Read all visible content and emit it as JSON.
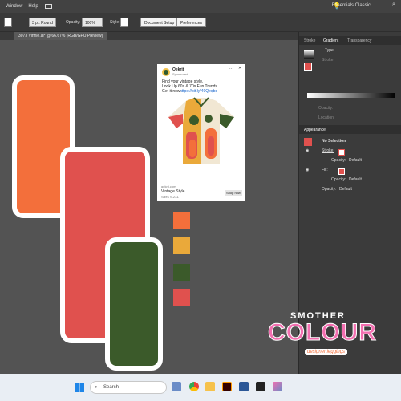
{
  "menu": {
    "items": [
      "Window",
      "Help"
    ],
    "workspace": "Essentials Classic"
  },
  "control_bar": {
    "stroke_weight": "3 pt. Round",
    "opacity_label": "Opacity:",
    "opacity_value": "100%",
    "style_label": "Style:",
    "document_setup": "Document Setup",
    "preferences": "Preferences"
  },
  "document_tab": {
    "title": "3073 Vinnie.ai* @ 66.67% (RGB/GPU Preview)"
  },
  "ad": {
    "brand": "Qekrit",
    "sponsored": "Sponsored",
    "line1": "Find your vintage style.",
    "line2": "Look Up 60s & 70s Fun Trends.",
    "line3": "Get it now:",
    "link": "https://bit.ly/49Qeqbd",
    "domain": "qekrit.com",
    "product_title": "Vintage Style",
    "product_sub": "Sizes S-2XL",
    "cta": "Shop now"
  },
  "panels": {
    "top_tabs": [
      "Stroke",
      "Gradient",
      "Transparency"
    ],
    "gradient_fields": [
      "Type:",
      "Stroke:",
      "Opacity:",
      "Location:"
    ],
    "appearance_tab": "Appearance",
    "no_selection": "No Selection",
    "stroke_label": "Stroke:",
    "opacity_label": "Opacity:",
    "opacity_default": "Default",
    "fill_label": "Fill:"
  },
  "watermark": {
    "line1": "SMOTHER",
    "line2": "COLOUR",
    "line3": "designer leggings"
  },
  "taskbar": {
    "search_placeholder": "Search"
  },
  "colors": {
    "orange": "#f36f3b",
    "red": "#e0514e",
    "green": "#3b5a2a",
    "gold": "#eaa93a",
    "swatches": [
      "#f36f3b",
      "#eaa93a",
      "#3b5a2a",
      "#e0514e"
    ]
  }
}
